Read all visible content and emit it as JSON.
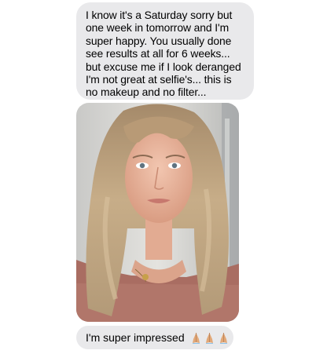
{
  "messages": [
    {
      "sender": "other",
      "type": "text",
      "text": "I know it's a Saturday sorry but one week in tomorrow and I'm super happy. You usually done see results at all for 6 weeks... but excuse me if I look deranged I'm not great at selfie's... this is no makeup and no filter..."
    },
    {
      "sender": "other",
      "type": "photo",
      "icon": "selfie-photo"
    },
    {
      "sender": "other",
      "type": "text",
      "text": "I'm super impressed",
      "emoji": "folded-hands-icon x3"
    }
  ],
  "colors": {
    "bubble": "#e9e9eb",
    "text": "#000000",
    "background": "#ffffff"
  }
}
